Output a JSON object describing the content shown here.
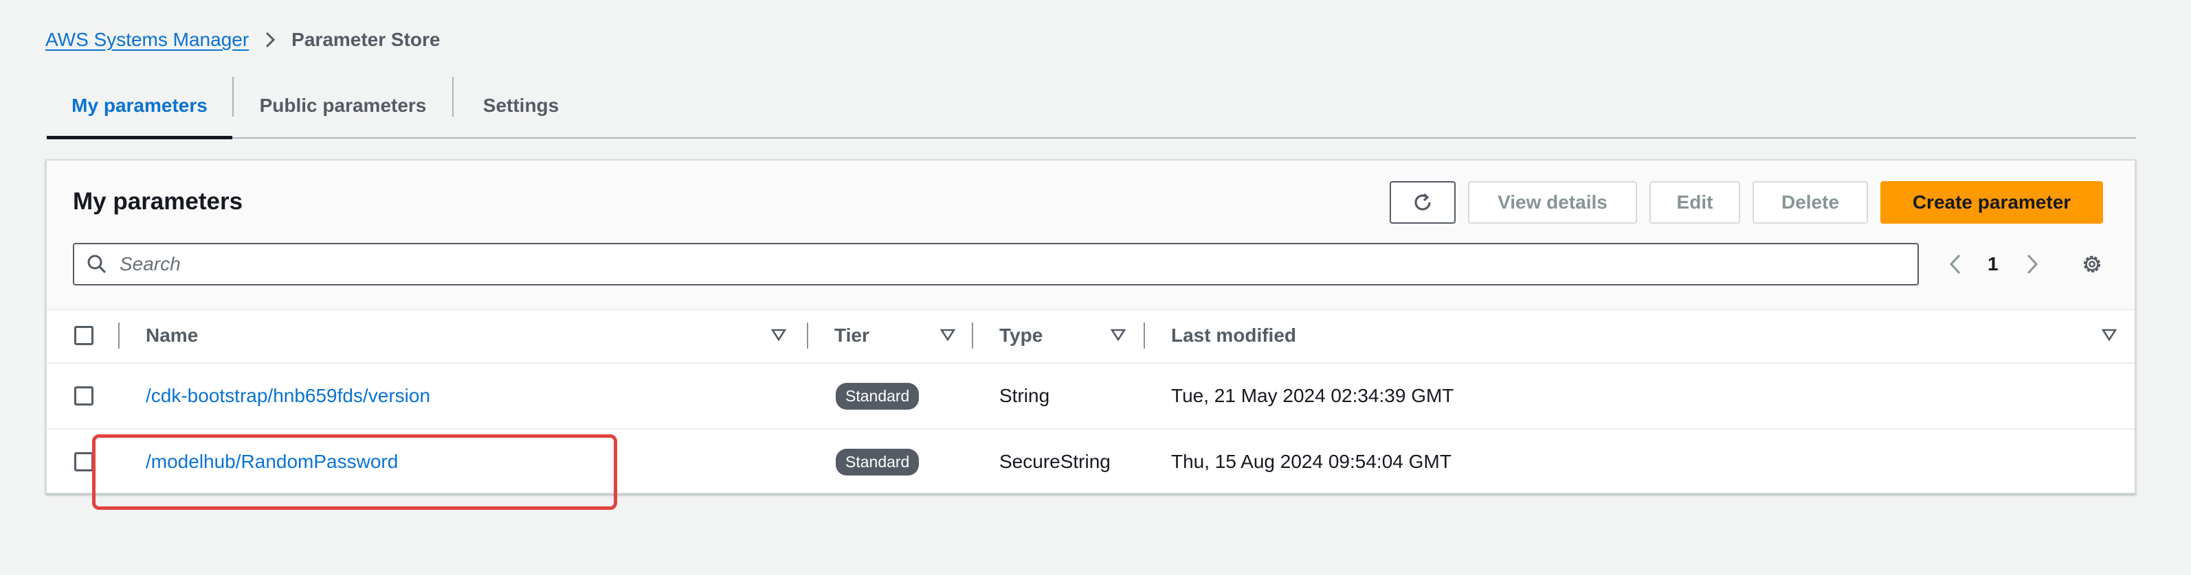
{
  "breadcrumb": {
    "parent": "AWS Systems Manager",
    "current": "Parameter Store",
    "separator_icon": "chevron-right-icon"
  },
  "tabs": [
    {
      "label": "My parameters",
      "active": true
    },
    {
      "label": "Public parameters",
      "active": false
    },
    {
      "label": "Settings",
      "active": false
    }
  ],
  "panel": {
    "title": "My parameters",
    "buttons": {
      "refresh_icon": "refresh-icon",
      "view_details": "View details",
      "edit": "Edit",
      "delete": "Delete",
      "create": "Create parameter"
    },
    "search": {
      "placeholder": "Search",
      "value": "",
      "icon": "search-icon"
    },
    "pagination": {
      "current_page": "1",
      "prev_icon": "chevron-left-icon",
      "next_icon": "chevron-right-icon"
    },
    "settings_icon": "gear-icon"
  },
  "table": {
    "columns": [
      {
        "label": "Name",
        "sort_icon": "sort-down-icon"
      },
      {
        "label": "Tier",
        "sort_icon": "sort-down-icon"
      },
      {
        "label": "Type",
        "sort_icon": "sort-down-icon"
      },
      {
        "label": "Last modified",
        "sort_icon": "sort-down-icon"
      }
    ],
    "rows": [
      {
        "name": "/cdk-bootstrap/hnb659fds/version",
        "tier": "Standard",
        "type": "String",
        "last_modified": "Tue, 21 May 2024 02:34:39 GMT",
        "selected": false
      },
      {
        "name": "/modelhub/RandomPassword",
        "tier": "Standard",
        "type": "SecureString",
        "last_modified": "Thu, 15 Aug 2024 09:54:04 GMT",
        "selected": false
      }
    ]
  },
  "colors": {
    "link": "#0972d3",
    "primary_button": "#ff9900",
    "badge": "#545b64",
    "highlight": "#e0443e",
    "page_background": "#f2f3f3"
  }
}
